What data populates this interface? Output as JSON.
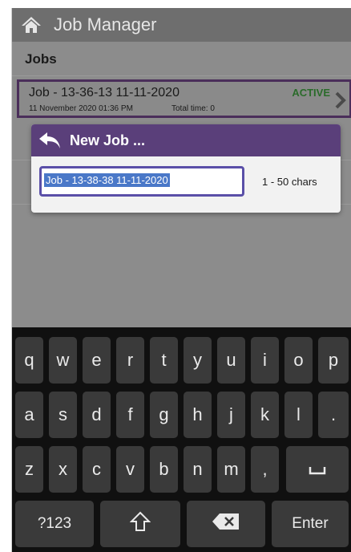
{
  "app": {
    "title": "Job Manager",
    "icon": "home-icon"
  },
  "section": {
    "header": "Jobs"
  },
  "jobs": [
    {
      "name": "Job - 13-36-13 11-11-2020",
      "date": "11 November 2020 01:36 PM",
      "total": "Total time: 0",
      "status": "ACTIVE",
      "status_color": "#2a6b2a"
    }
  ],
  "dialog": {
    "title": "New Job ...",
    "back_icon": "back-arrow-icon",
    "input_value": "Job - 13-38-38 11-11-2020",
    "hint": "1 - 50 chars"
  },
  "keyboard": {
    "row1": [
      "q",
      "w",
      "e",
      "r",
      "t",
      "y",
      "u",
      "i",
      "o",
      "p"
    ],
    "row2": [
      "a",
      "s",
      "d",
      "f",
      "g",
      "h",
      "j",
      "k",
      "l",
      "."
    ],
    "row3": [
      "z",
      "x",
      "c",
      "v",
      "b",
      "n",
      "m",
      ","
    ],
    "sym_label": "?123",
    "enter_label": "Enter",
    "shift_icon": "shift-icon",
    "backspace_icon": "backspace-icon",
    "space_icon": "space-icon"
  },
  "colors": {
    "titlebar": "#6e6e6e",
    "dialog_header": "#5a3f7a",
    "accent": "#5a4fa8",
    "selection": "#4a78c8"
  }
}
